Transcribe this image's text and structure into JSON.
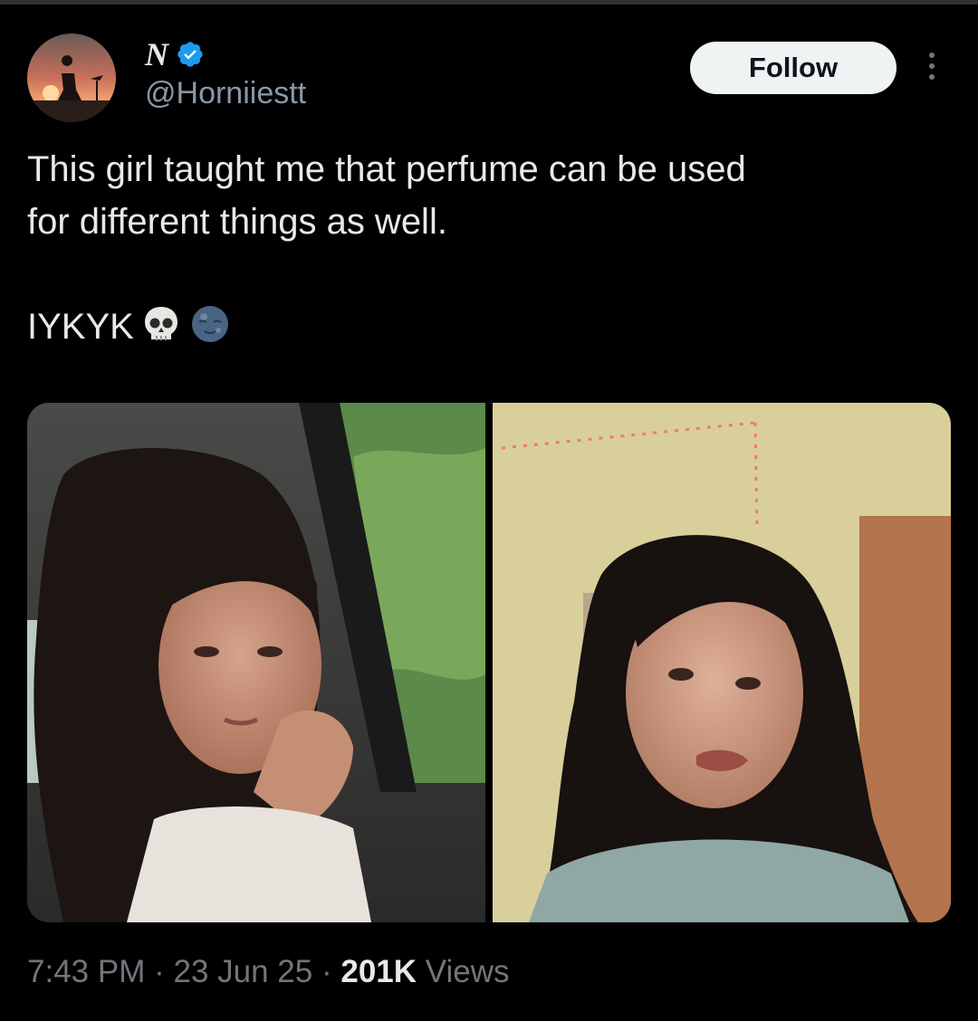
{
  "author": {
    "display_name": "N",
    "handle": "@Horniiestt",
    "verified": true,
    "avatar_icon": "silhouette-sunset-avatar"
  },
  "actions": {
    "follow_label": "Follow",
    "more_icon": "more-vertical-icon"
  },
  "tweet": {
    "lines": [
      "This girl taught me that perfume can be used",
      "for different things as well."
    ],
    "tag_line": "IYKYK",
    "emojis": [
      "skull-emoji",
      "new-moon-face-emoji"
    ]
  },
  "media": [
    {
      "icon": "photo-woman-in-car"
    },
    {
      "icon": "photo-woman-in-room"
    }
  ],
  "meta": {
    "time": "7:43 PM",
    "separator": "·",
    "date": "23 Jun 25",
    "views_count": "201K",
    "views_label": "Views"
  },
  "colors": {
    "background": "#000000",
    "text_primary": "#e7e9ea",
    "text_secondary": "#71767b",
    "verified_blue": "#1d9bf0",
    "follow_bg": "#eff3f4"
  }
}
